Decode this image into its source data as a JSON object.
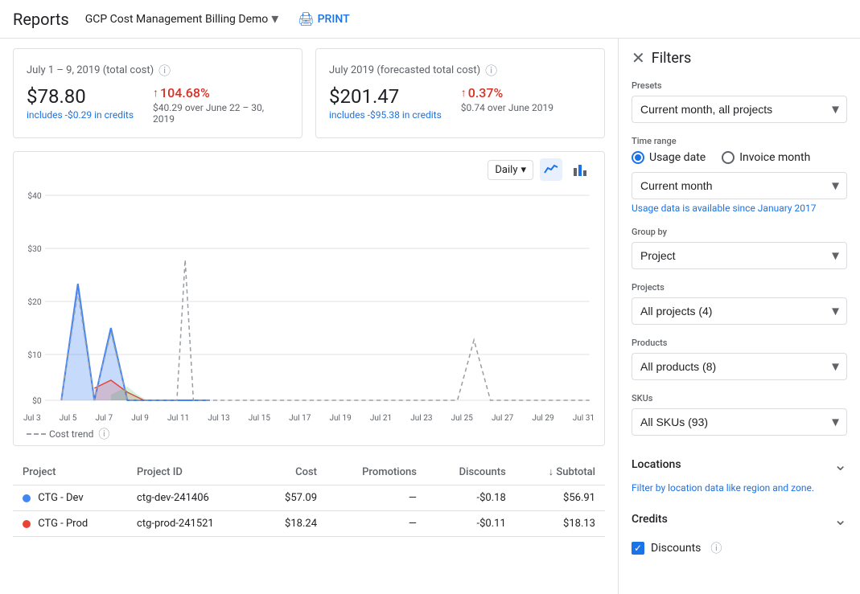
{
  "header": {
    "title": "Reports",
    "project": "GCP Cost Management Billing Demo",
    "print_label": "PRINT"
  },
  "summary": {
    "card1": {
      "title": "July 1 – 9, 2019 (total cost)",
      "amount": "$78.80",
      "sub": "includes -$0.29 in credits",
      "change": "104.68%",
      "change_sub": "$40.29 over June 22 – 30, 2019"
    },
    "card2": {
      "title": "July 2019 (forecasted total cost)",
      "amount": "$201.47",
      "sub": "includes -$95.38 in credits",
      "change": "0.37%",
      "change_sub": "$0.74 over June 2019"
    }
  },
  "chart": {
    "controls": {
      "daily_label": "Daily"
    },
    "x_labels": [
      "Jul 3",
      "Jul 5",
      "Jul 7",
      "Jul 9",
      "Jul 11",
      "Jul 13",
      "Jul 15",
      "Jul 17",
      "Jul 19",
      "Jul 21",
      "Jul 23",
      "Jul 25",
      "Jul 27",
      "Jul 29",
      "Jul 31"
    ],
    "y_labels": [
      "$40",
      "$30",
      "$20",
      "$10",
      "$0"
    ],
    "legend_label": "Cost trend"
  },
  "table": {
    "columns": [
      "Project",
      "Project ID",
      "Cost",
      "Promotions",
      "Discounts",
      "Subtotal"
    ],
    "rows": [
      {
        "color": "#4285f4",
        "project": "CTG - Dev",
        "project_id": "ctg-dev-241406",
        "cost": "$57.09",
        "promotions": "—",
        "discounts": "-$0.18",
        "subtotal": "$56.91"
      },
      {
        "color": "#ea4335",
        "project": "CTG - Prod",
        "project_id": "ctg-prod-241521",
        "cost": "$18.24",
        "promotions": "—",
        "discounts": "-$0.11",
        "subtotal": "$18.13"
      }
    ]
  },
  "filters": {
    "title": "Filters",
    "presets": {
      "label": "Presets",
      "value": "Current month, all projects"
    },
    "time_range": {
      "label": "Time range",
      "options": [
        "Usage date",
        "Invoice month"
      ],
      "selected": "Usage date"
    },
    "current_month": {
      "value": "Current month",
      "hint": "Usage data is available since January 2017"
    },
    "group_by": {
      "label": "Group by",
      "value": "Project"
    },
    "projects": {
      "label": "Projects",
      "value": "All projects (4)"
    },
    "products": {
      "label": "Products",
      "value": "All products (8)"
    },
    "skus": {
      "label": "SKUs",
      "value": "All SKUs (93)"
    },
    "locations": {
      "label": "Locations",
      "hint": "Filter by location data like region and zone."
    },
    "credits": {
      "label": "Credits",
      "discounts_label": "Discounts"
    }
  }
}
